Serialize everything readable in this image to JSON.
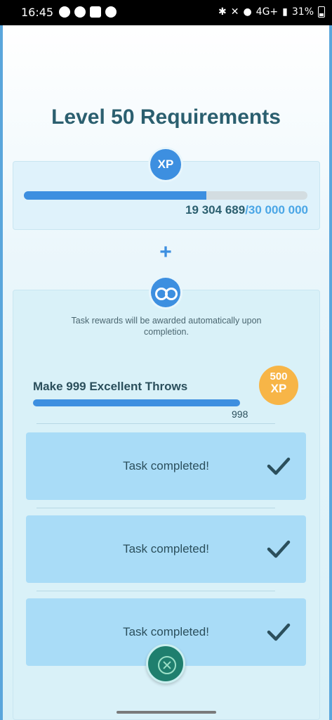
{
  "status_bar": {
    "time": "16:45",
    "battery": "31%",
    "signal": "4G+"
  },
  "page": {
    "title": "Level 50 Requirements"
  },
  "xp_requirement": {
    "badge": "XP",
    "current": "19 304 689",
    "goal": "/30 000 000",
    "progress_fraction": 0.6435
  },
  "plus_symbol": "+",
  "tasks": {
    "icon": "binoculars-icon",
    "note": "Task rewards will be awarded automatically upon completion.",
    "active_task": {
      "name": "Make 999 Excellent Throws",
      "count": "998",
      "reward_amount": "500",
      "reward_unit": "XP"
    },
    "completed": [
      {
        "label": "Task completed!"
      },
      {
        "label": "Task completed!"
      },
      {
        "label": "Task completed!"
      }
    ]
  },
  "colors": {
    "accent": "#3d8fe0",
    "title": "#2b5f6f",
    "reward": "#f7b547",
    "completed_row": "#a9dcf7",
    "close_button": "#1f7f6e"
  }
}
